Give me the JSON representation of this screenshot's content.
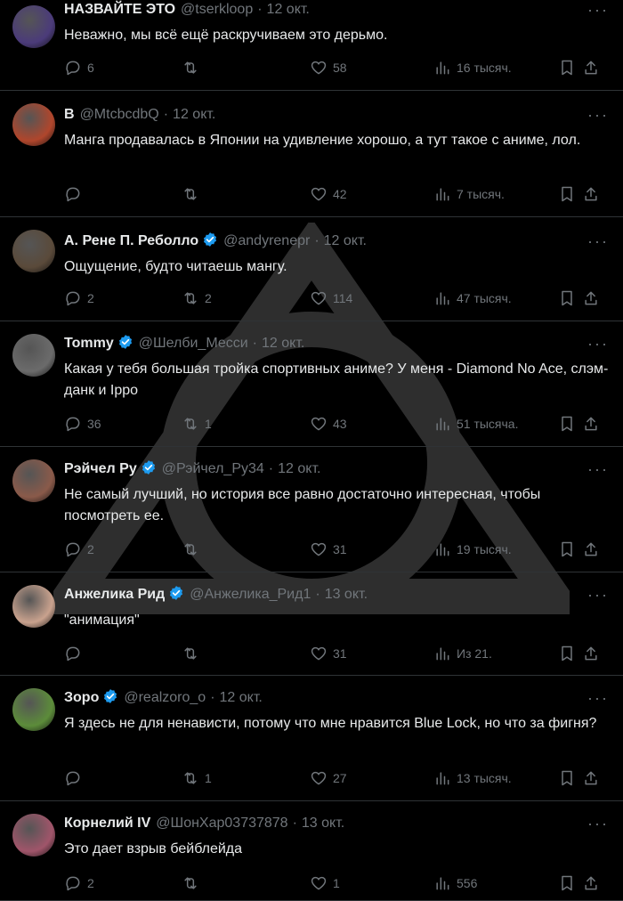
{
  "tweets": [
    {
      "name": "НАЗВАЙТЕ ЭТО",
      "verified": false,
      "handle": "@tserkloop",
      "date": "12 окт.",
      "text": "Неважно, мы всё ещё раскручиваем это дерьмо.",
      "replies": "6",
      "retweets": "",
      "likes": "58",
      "views": "16 тысяч.",
      "avatar_color": "#4b3b7a"
    },
    {
      "name": "B",
      "verified": false,
      "handle": "@MtcbcdbQ",
      "date": "12 окт.",
      "text": "Манга продавалась в Японии на удивление хорошо, а тут такое с аниме, лол.",
      "replies": "",
      "retweets": "",
      "likes": "42",
      "views": "7 тысяч.",
      "avatar_color": "#b0462c"
    },
    {
      "name": "А. Рене П. Реболло",
      "verified": true,
      "handle": "@andyrenepr",
      "date": "12 окт.",
      "text": "Ощущение, будто читаешь мангу.",
      "replies": "2",
      "retweets": "2",
      "likes": "114",
      "views": "47 тысяч.",
      "avatar_color": "#5a4a3a"
    },
    {
      "name": "Tommy",
      "verified": true,
      "handle": "@Шелби_Месси",
      "date": "12 окт.",
      "text": "Какая у тебя большая тройка спортивных аниме? У меня - Diamond No Ace, слэм-данк и Ippo",
      "replies": "36",
      "retweets": "1",
      "likes": "43",
      "views": "51 тысяча.",
      "avatar_color": "#6b6b6b"
    },
    {
      "name": "Рэйчел Ру",
      "verified": true,
      "handle": "@Рэйчел_Ру34",
      "date": "12 окт.",
      "text": "Не самый лучший, но история все равно достаточно интересная, чтобы посмотреть ее.",
      "replies": "2",
      "retweets": "",
      "likes": "31",
      "views": "19 тысяч.",
      "avatar_color": "#8a5a4a"
    },
    {
      "name": "Анжелика Рид",
      "verified": true,
      "handle": "@Анжелика_Рид1",
      "date": "13 окт.",
      "text": "\"анимация\"",
      "replies": "",
      "retweets": "",
      "likes": "31",
      "views": "Из 21.",
      "avatar_color": "#c9a28e"
    },
    {
      "name": "Зоро",
      "verified": true,
      "handle": "@realzoro_o",
      "date": "12 окт.",
      "text": "Я здесь не для ненависти, потому что мне нравится Blue Lock, но что за фигня?",
      "replies": "",
      "retweets": "1",
      "likes": "27",
      "views": "13 тысяч.",
      "avatar_color": "#5c8c3a"
    },
    {
      "name": "Корнелий IV",
      "verified": false,
      "handle": "@ШонХар03737878",
      "date": "13 окт.",
      "text": "Это дает взрыв бейблейда",
      "replies": "2",
      "retweets": "",
      "likes": "1",
      "views": "556",
      "avatar_color": "#a0556a"
    }
  ],
  "colors": {
    "background": "#000000",
    "text": "#e7e9ea",
    "muted": "#71767b",
    "divider": "#2f3336",
    "verified": "#1d9bf0"
  },
  "icons": {
    "reply": "reply-icon",
    "retweet": "retweet-icon",
    "like": "heart-icon",
    "views": "views-icon",
    "bookmark": "bookmark-icon",
    "share": "share-icon",
    "more": "more-icon",
    "verified": "verified-badge-icon"
  }
}
